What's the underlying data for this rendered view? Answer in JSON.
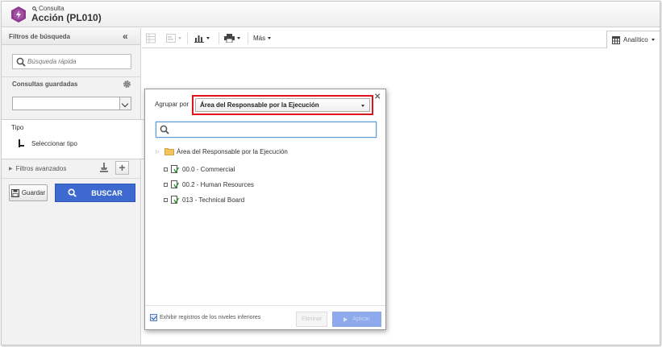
{
  "header": {
    "subtitle": "Consulta",
    "title": "Acción (PL010)"
  },
  "sidebar": {
    "title": "Filtros de búsqueda",
    "quick_search_placeholder": "Búsqueda rápida",
    "saved_queries_label": "Consultas guardadas",
    "saved_queries_value": "",
    "type_label": "Tipo",
    "select_type_label": "Seleccionar tipo",
    "advanced_filters_label": "Filtros avanzados",
    "save_label": "Guardar",
    "search_label": "BUSCAR"
  },
  "toolbar": {
    "more_label": "Más",
    "view_label": "Analítico"
  },
  "dialog": {
    "group_by_label": "Agrupar por",
    "group_by_value": "Área del Responsable por la Ejecución",
    "search_value": "",
    "tree": {
      "root_label": "Área del Responsable por la Ejecución",
      "children": [
        "00.0 - Commercial",
        "00.2 - Human Resources",
        "013 - Technical Board"
      ]
    },
    "show_lower_levels_label": "Exhibir registros de los niveles inferiores",
    "show_lower_levels_checked": true,
    "clear_label": "Eliminar",
    "apply_label": "Aplicar"
  },
  "colors": {
    "accent": "#3e6ad0",
    "highlight_border": "#e0151c",
    "logo": "#8e3c8e"
  }
}
